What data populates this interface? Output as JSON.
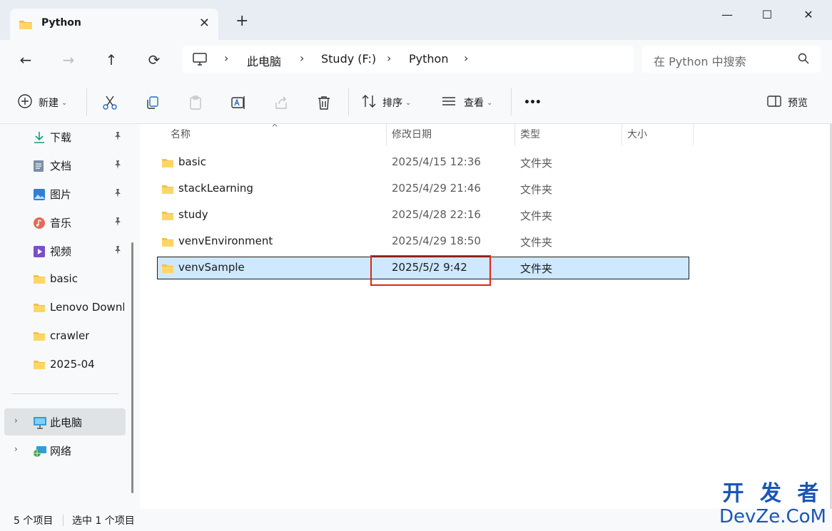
{
  "tab": {
    "title": "Python",
    "new_tab": "+"
  },
  "window": {
    "minimize": "—",
    "maximize": "☐",
    "close": "✕"
  },
  "nav": {
    "back": "←",
    "forward": "→",
    "up": "↑",
    "refresh": "⟳"
  },
  "breadcrumb": [
    "此电脑",
    "Study (F:)",
    "Python"
  ],
  "search": {
    "placeholder": "在 Python 中搜索"
  },
  "toolbar": {
    "new_label": "新建",
    "sort_label": "排序",
    "view_label": "查看",
    "more_label": "•••",
    "preview_label": "预览"
  },
  "sidebar": {
    "items": [
      {
        "label": "下载",
        "icon": "download-icon",
        "pinned": true
      },
      {
        "label": "文档",
        "icon": "document-icon",
        "pinned": true
      },
      {
        "label": "图片",
        "icon": "picture-icon",
        "pinned": true
      },
      {
        "label": "音乐",
        "icon": "music-icon",
        "pinned": true
      },
      {
        "label": "视频",
        "icon": "video-icon",
        "pinned": true
      },
      {
        "label": "basic",
        "icon": "folder-icon"
      },
      {
        "label": "Lenovo Downloads",
        "icon": "folder-icon"
      },
      {
        "label": "crawler",
        "icon": "folder-icon"
      },
      {
        "label": "2025-04",
        "icon": "folder-icon"
      }
    ],
    "this_pc": "此电脑",
    "network": "网络"
  },
  "columns": {
    "name": "名称",
    "date": "修改日期",
    "type": "类型",
    "size": "大小"
  },
  "files": [
    {
      "name": "basic",
      "date": "2025/4/15 12:36",
      "type": "文件夹"
    },
    {
      "name": "stackLearning",
      "date": "2025/4/29 21:46",
      "type": "文件夹"
    },
    {
      "name": "study",
      "date": "2025/4/28 22:16",
      "type": "文件夹"
    },
    {
      "name": "venvEnvironment",
      "date": "2025/4/29 18:50",
      "type": "文件夹"
    },
    {
      "name": "venvSample",
      "date": "2025/5/2 9:42",
      "type": "文件夹",
      "selected": true
    }
  ],
  "status": {
    "count": "5 个项目",
    "selected": "选中 1 个项目"
  },
  "watermark": {
    "top": "开 发 者",
    "bottom": "DevZe.CoM"
  },
  "colors": {
    "accent": "#0067c0",
    "selection": "#cde8ff",
    "highlight_box": "#e2231a",
    "folder": "#f4c14b"
  }
}
